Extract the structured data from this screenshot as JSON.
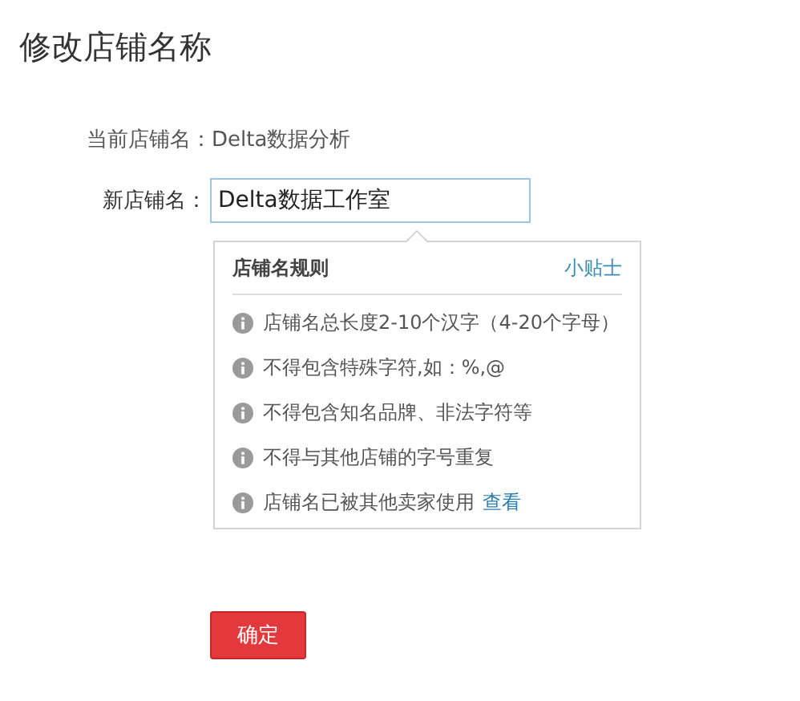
{
  "title": "修改店铺名称",
  "current": {
    "label": "当前店铺名：",
    "value": "Delta数据分析"
  },
  "new_name": {
    "label": "新店铺名：",
    "value": "Delta数据工作室"
  },
  "rules_popover": {
    "title": "店铺名规则",
    "tip_link": "小贴士",
    "rules": [
      {
        "text": "店铺名总长度2-10个汉字（4-20个字母）"
      },
      {
        "text": "不得包含特殊字符,如：%,@"
      },
      {
        "text": "不得包含知名品牌、非法字符等"
      },
      {
        "text": "不得与其他店铺的字号重复"
      },
      {
        "text": "店铺名已被其他卖家使用",
        "link": "查看"
      }
    ]
  },
  "confirm_button": "确定"
}
